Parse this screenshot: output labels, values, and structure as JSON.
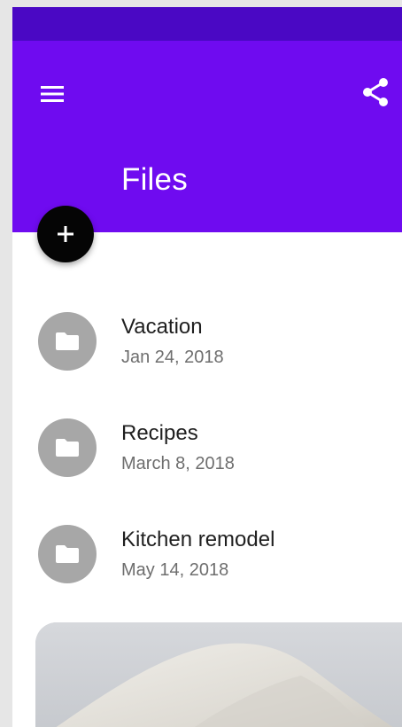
{
  "app_bar": {
    "title": "Files",
    "menu_icon": "hamburger-menu-icon",
    "share_icon": "share-icon",
    "color": "#6f0bf0",
    "status_bar_color": "#4a08c4"
  },
  "fab": {
    "icon": "plus-icon",
    "color": "#050505"
  },
  "files": [
    {
      "name": "Vacation",
      "date": "Jan 24, 2018",
      "icon": "folder-icon"
    },
    {
      "name": "Recipes",
      "date": "March 8, 2018",
      "icon": "folder-icon"
    },
    {
      "name": "Kitchen remodel",
      "date": "May 14, 2018",
      "icon": "folder-icon"
    }
  ],
  "photo_card": {
    "image": "sand-pile-photo"
  }
}
